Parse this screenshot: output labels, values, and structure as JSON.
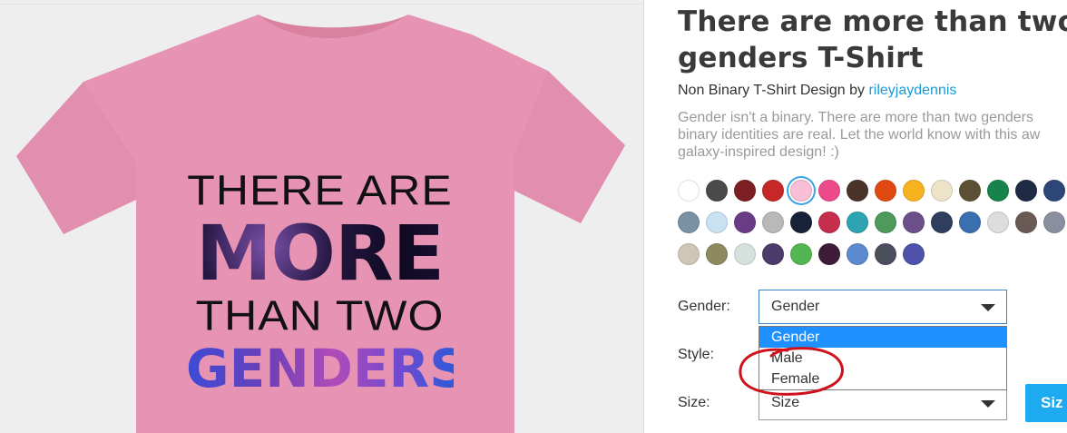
{
  "product": {
    "title_line1": "There are more than two",
    "title_line2": "genders T-Shirt",
    "byline_prefix": "Non Binary T-Shirt Design by",
    "artist": "rileyjaydennis",
    "description_line1": "Gender isn't a binary. There are more than two genders",
    "description_line2": "binary identities are real. Let the world know with this aw",
    "description_line3": "galaxy-inspired design! :)"
  },
  "design": {
    "line1": "THERE ARE",
    "line2": "MORE",
    "line3": "THAN TWO",
    "line4": "GENDERS"
  },
  "swatches": {
    "selected_color": "#f8bfd6",
    "row1": [
      "#ffffff",
      "#4a4a4a",
      "#7b1f24",
      "#c62828",
      "#f8bfd6",
      "#ec4a8b",
      "#4a3328",
      "#e04a12",
      "#f7b21f",
      "#ede3c8",
      "#5c5034",
      "#17834a",
      "#1f2a44",
      "#2d4577"
    ],
    "row2": [
      "#7a91a4",
      "#c9e2f2",
      "#6a3c86",
      "#b9b9b9",
      "#172238",
      "#c52f4b",
      "#2ea3b1",
      "#4d9a5c",
      "#6a4f88",
      "#2f3e5e",
      "#3a6fb0",
      "#dddddd",
      "#6a5a55",
      "#8a8fa0"
    ],
    "row3": [
      "#cfc6b8",
      "#8f8a5e",
      "#d6e0dc",
      "#4a3c6a",
      "#52b652",
      "#3e1b36",
      "#5b8ad0",
      "#4b4f5c",
      "#4f52a8"
    ]
  },
  "form": {
    "gender_label": "Gender:",
    "gender_value": "Gender",
    "style_label": "Style:",
    "size_label": "Size:",
    "size_value": "Size",
    "size_button": "Siz",
    "gender_options": [
      "Gender",
      "Male",
      "Female"
    ]
  },
  "colors": {
    "accent": "#1eaaf1",
    "link": "#1a9ad6",
    "dropdown_highlight": "#1e90ff",
    "shirt": "#e693b4",
    "annotation": "#d0111b"
  }
}
